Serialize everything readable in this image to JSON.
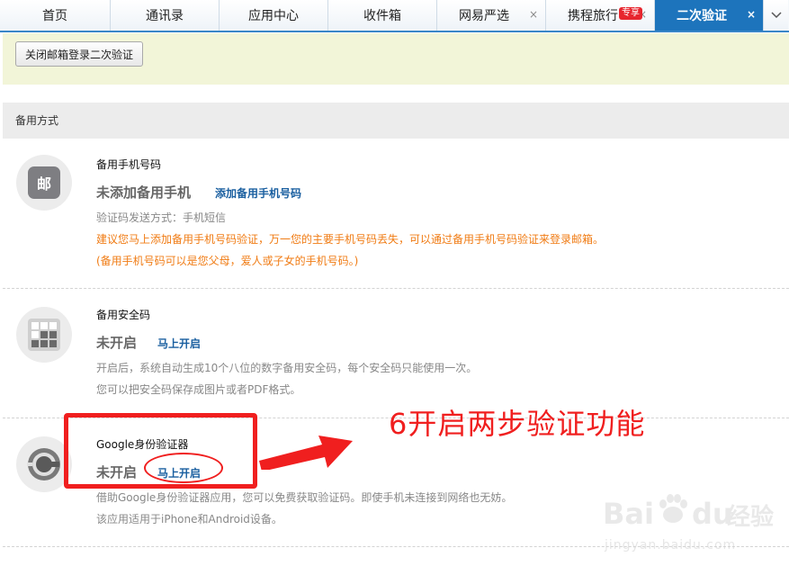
{
  "tabs": [
    {
      "label": "首页",
      "closable": false,
      "active": false
    },
    {
      "label": "通讯录",
      "closable": false,
      "active": false
    },
    {
      "label": "应用中心",
      "closable": false,
      "active": false
    },
    {
      "label": "收件箱",
      "closable": false,
      "active": false
    },
    {
      "label": "网易严选",
      "closable": true,
      "active": false
    },
    {
      "label": "携程旅行",
      "closable": true,
      "active": false,
      "badge": "专享"
    },
    {
      "label": "二次验证",
      "closable": true,
      "active": true
    }
  ],
  "close_icon": "×",
  "more_icon": "chevron-down-icon",
  "toolbar": {
    "close_2fa_label": "关闭邮箱登录二次验证"
  },
  "section": {
    "title": "备用方式"
  },
  "phone": {
    "title": "备用手机号码",
    "status": "未添加备用手机",
    "action": "添加备用手机号码",
    "method": "验证码发送方式：手机短信",
    "advice": "建议您马上添加备用手机号码验证，万一您的主要手机号码丢失，可以通过备用手机号码验证来登录邮箱。",
    "note": "(备用手机号码可以是您父母，爱人或子女的手机号码。)",
    "icon": "mail-logo-icon"
  },
  "code": {
    "title": "备用安全码",
    "status": "未开启",
    "action": "马上开启",
    "desc1": "开启后，系统自动生成10个八位的数字备用安全码，每个安全码只能使用一次。",
    "desc2": "您可以把安全码保存成图片或者PDF格式。",
    "icon": "grid-icon"
  },
  "google": {
    "title": "Google身份验证器",
    "status": "未开启",
    "action": "马上开启",
    "desc1": "借助Google身份验证器应用，您可以免费获取验证码。即使手机未连接到网络也无妨。",
    "desc2": "该应用适用于iPhone和Android设备。",
    "icon": "authenticator-icon"
  },
  "annotation": {
    "text": "6开启两步验证功能",
    "color": "#f01f1f"
  },
  "watermark": {
    "brand": "Bai",
    "brand2": "du",
    "suffix": "经验",
    "url": "jingyan.baidu.com"
  },
  "colors": {
    "accent": "#1d74bc",
    "link": "#1a5fa0",
    "warning": "#f07b13",
    "annotation": "#f01f1f"
  }
}
